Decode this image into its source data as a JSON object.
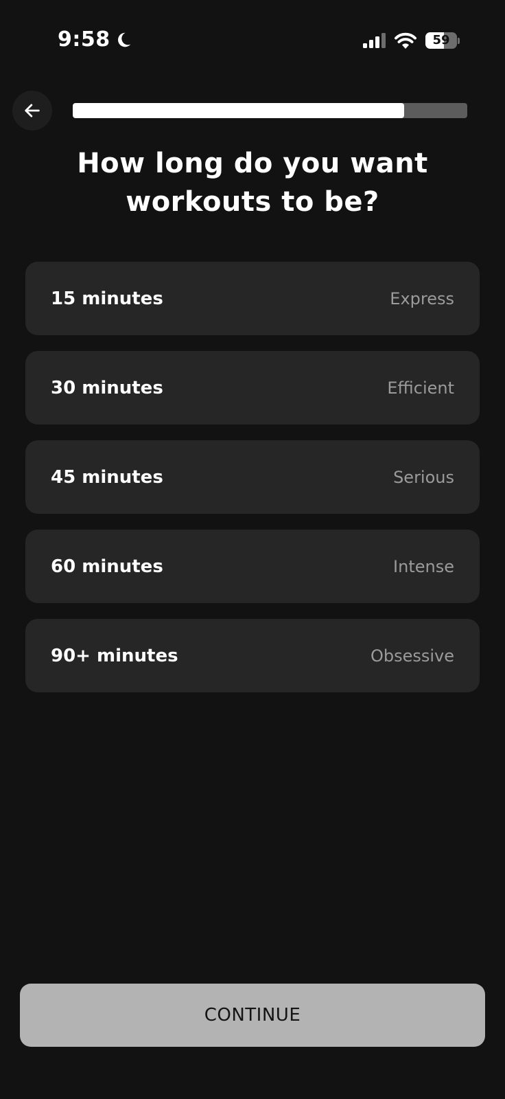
{
  "status_bar": {
    "time": "9:58",
    "battery_level": "59",
    "battery_fraction": 0.59
  },
  "icons": {
    "moon": "moon-icon",
    "signal": "cellular-signal-icon",
    "wifi": "wifi-icon",
    "battery": "battery-icon",
    "back": "arrow-left-icon"
  },
  "progress": {
    "fraction": 0.84
  },
  "title": "How long do you want workouts to be?",
  "options": [
    {
      "label": "15 minutes",
      "description": "Express"
    },
    {
      "label": "30 minutes",
      "description": "Efficient"
    },
    {
      "label": "45 minutes",
      "description": "Serious"
    },
    {
      "label": "60 minutes",
      "description": "Intense"
    },
    {
      "label": "90+ minutes",
      "description": "Obsessive"
    }
  ],
  "continue_label": "CONTINUE",
  "colors": {
    "background": "#121212",
    "option_background": "#262626",
    "option_description": "#9b9b9b",
    "continue_background": "#b3b3b3"
  }
}
